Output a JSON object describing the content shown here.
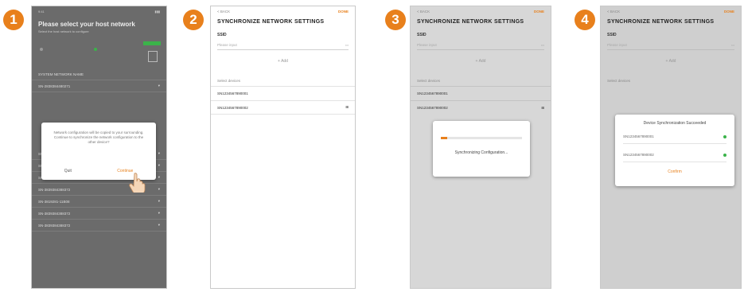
{
  "steps": [
    "1",
    "2",
    "3",
    "4"
  ],
  "colors": {
    "accent": "#e8801c",
    "success": "#3bb34a"
  },
  "phone1": {
    "status": "9:41",
    "title": "Please select your host network",
    "subtitle": "Select the host network to configure",
    "rows": [
      "SYSTEM NETWORK NAME",
      "SN-2838384480271",
      "SN-",
      "SN - ABAH871",
      "SN-3398471737-BC981",
      "SN-3839384388372",
      "SN-3819281-11B08",
      "SN-3839384388372",
      "SN-3839384388372"
    ],
    "dialog_text": "Network configuration will be copied to your surrounding. Continue to synchronize the network configuration to the other device?",
    "cancel": "Quit",
    "continue": "Continue"
  },
  "phone2": {
    "back": "< BACK",
    "action": "DONE",
    "title": "SYNCHRONIZE NETWORK SETTINGS",
    "ssid_label": "SSID",
    "ssid_placeholder": "Please input",
    "password_button": "+ Add",
    "section": "Select devices",
    "devices": [
      "SN1234567890001",
      "SN1234567890002"
    ]
  },
  "phone3": {
    "back": "< BACK",
    "action": "DONE",
    "title": "SYNCHRONIZE NETWORK SETTINGS",
    "ssid_label": "SSID",
    "ssid_placeholder": "Please input",
    "password_button": "+ Add",
    "section": "Select devices",
    "device1": "SN1234567890001",
    "device2": "SN1234567890002",
    "progress": 0.08,
    "dialog_text": "Synchronizing Configuration..."
  },
  "phone4": {
    "back": "< BACK",
    "action": "DONE",
    "title": "SYNCHRONIZE NETWORK SETTINGS",
    "ssid_label": "SSID",
    "ssid_placeholder": "Please input",
    "password_button": "+ Add",
    "section": "Select devices",
    "dialog_title": "Device Synchronization Succeeded",
    "devices": [
      "SN1234567890001",
      "SN1234567890002"
    ],
    "confirm": "Confirm"
  }
}
